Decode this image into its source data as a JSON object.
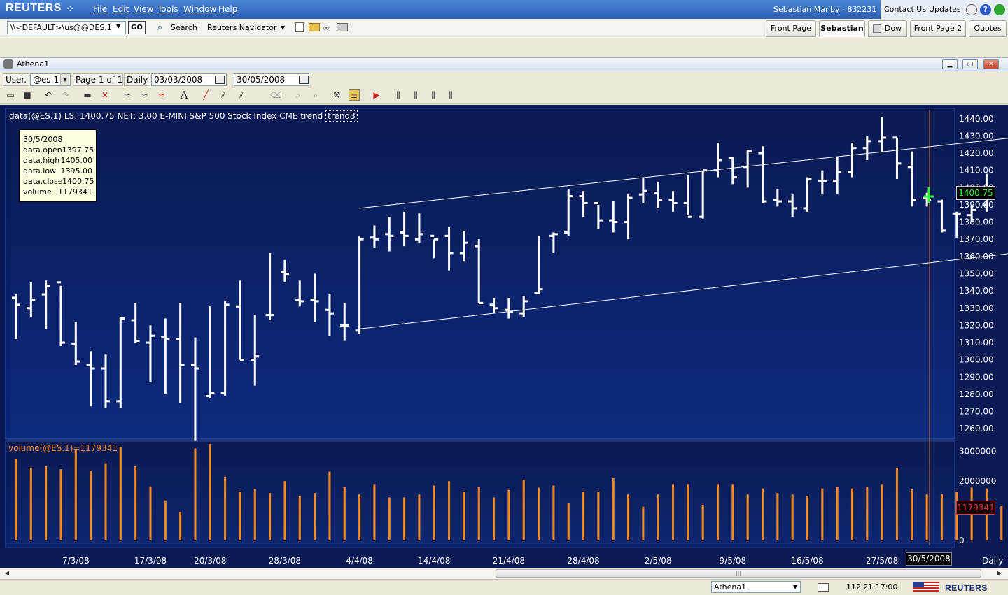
{
  "app": {
    "brand": "REUTERS",
    "menu": [
      "File",
      "Edit",
      "View",
      "Tools",
      "Window",
      "Help"
    ],
    "user": "Sebastian Manby - 832231",
    "contact": "Contact Us",
    "updates": "Updates"
  },
  "toolbar": {
    "ric_value": "\\\\<DEFAULT>\\us@@DES.1",
    "go_label": "GO",
    "search_label": "Search",
    "navigator_label": "Reuters Navigator",
    "tabs": [
      {
        "label": "Front Page",
        "active": false
      },
      {
        "label": "Sebastian",
        "active": true
      },
      {
        "label": "Dow",
        "active": false
      },
      {
        "label": "Front Page 2",
        "active": false
      },
      {
        "label": "Quotes",
        "active": false
      }
    ]
  },
  "window": {
    "title": "Athena1",
    "user_label": "User.",
    "symbol": "@es.1",
    "page_label": "Page 1 of 1",
    "interval": "Daily",
    "start_date": "03/03/2008",
    "end_date": "30/05/2008"
  },
  "chart_data": {
    "type": "ohlc",
    "header": "data(@ES.1) LS: 1400.75  NET: 3.00   E-MINI S&P 500 Stock Index CME trend",
    "trend_label": "trend3",
    "volume_label": "volume(@ES.1)=1179341",
    "last_price": "1400.75",
    "last_volume": "1179341",
    "period": "Daily",
    "cursor_date": "30/5/2008",
    "tooltip": [
      {
        "k": "30/5/2008",
        "v": ""
      },
      {
        "k": "data.open",
        "v": "1397.75"
      },
      {
        "k": "data.high",
        "v": "1405.00"
      },
      {
        "k": "data.low",
        "v": "1395.00"
      },
      {
        "k": "data.close",
        "v": "1400.75"
      },
      {
        "k": "volume",
        "v": "1179341"
      }
    ],
    "y_ticks": [
      1440,
      1430,
      1420,
      1410,
      1400,
      1390,
      1380,
      1370,
      1360,
      1350,
      1340,
      1330,
      1320,
      1310,
      1300,
      1290,
      1280,
      1270,
      1260
    ],
    "y_range": [
      1254,
      1446
    ],
    "volume_ticks": [
      3000000,
      2000000,
      0
    ],
    "volume_range": [
      0,
      3300000
    ],
    "x_ticks": [
      "7/3/08",
      "17/3/08",
      "20/3/08",
      "28/3/08",
      "4/4/08",
      "14/4/08",
      "21/4/08",
      "28/4/08",
      "2/5/08",
      "9/5/08",
      "16/5/08",
      "27/5/08"
    ],
    "x_tick_bar_index": [
      4,
      9,
      13,
      18,
      23,
      28,
      33,
      38,
      43,
      48,
      53,
      58
    ],
    "bars": [
      {
        "o": 1336,
        "h": 1338,
        "l": 1312,
        "c": 1332,
        "v": 2750000
      },
      {
        "o": 1330,
        "h": 1345,
        "l": 1325,
        "c": 1335,
        "v": 2450000
      },
      {
        "o": 1338,
        "h": 1346,
        "l": 1318,
        "c": 1343,
        "v": 2500000
      },
      {
        "o": 1345,
        "h": 1343,
        "l": 1308,
        "c": 1310,
        "v": 2400000
      },
      {
        "o": 1309,
        "h": 1322,
        "l": 1297,
        "c": 1299,
        "v": 3050000
      },
      {
        "o": 1297,
        "h": 1305,
        "l": 1273,
        "c": 1295,
        "v": 2350000
      },
      {
        "o": 1295,
        "h": 1303,
        "l": 1272,
        "c": 1276,
        "v": 2600000
      },
      {
        "o": 1276,
        "h": 1325,
        "l": 1272,
        "c": 1324,
        "v": 3150000
      },
      {
        "o": 1323,
        "h": 1333,
        "l": 1310,
        "c": 1311,
        "v": 2500000
      },
      {
        "o": 1310,
        "h": 1320,
        "l": 1287,
        "c": 1314,
        "v": 1820000
      },
      {
        "o": 1313,
        "h": 1324,
        "l": 1280,
        "c": 1312,
        "v": 1350000
      },
      {
        "o": 1312,
        "h": 1333,
        "l": 1275,
        "c": 1297,
        "v": 960000
      },
      {
        "o": 1297,
        "h": 1313,
        "l": 1253,
        "c": 1295,
        "v": 3100000
      },
      {
        "o": 1279,
        "h": 1331,
        "l": 1278,
        "c": 1281,
        "v": 3250000
      },
      {
        "o": 1281,
        "h": 1334,
        "l": 1279,
        "c": 1332,
        "v": 2150000
      },
      {
        "o": 1331,
        "h": 1346,
        "l": 1300,
        "c": 1300,
        "v": 1650000
      },
      {
        "o": 1300,
        "h": 1326,
        "l": 1285,
        "c": 1302,
        "v": 1730000
      },
      {
        "o": 1326,
        "h": 1362,
        "l": 1323,
        "c": 1326,
        "v": 1600000
      },
      {
        "o": 1351,
        "h": 1358,
        "l": 1345,
        "c": 1350,
        "v": 2000000
      },
      {
        "o": 1335,
        "h": 1346,
        "l": 1331,
        "c": 1334,
        "v": 1500000
      },
      {
        "o": 1335,
        "h": 1350,
        "l": 1322,
        "c": 1334,
        "v": 1600000
      },
      {
        "o": 1329,
        "h": 1338,
        "l": 1314,
        "c": 1327,
        "v": 2320000
      },
      {
        "o": 1320,
        "h": 1333,
        "l": 1311,
        "c": 1320,
        "v": 1800000
      },
      {
        "o": 1317,
        "h": 1372,
        "l": 1315,
        "c": 1370,
        "v": 1550000
      },
      {
        "o": 1371,
        "h": 1378,
        "l": 1365,
        "c": 1370,
        "v": 1900000
      },
      {
        "o": 1373,
        "h": 1383,
        "l": 1363,
        "c": 1372,
        "v": 1450000
      },
      {
        "o": 1374,
        "h": 1386,
        "l": 1366,
        "c": 1372,
        "v": 1450000
      },
      {
        "o": 1370,
        "h": 1385,
        "l": 1368,
        "c": 1373,
        "v": 1550000
      },
      {
        "o": 1372,
        "h": 1370,
        "l": 1359,
        "c": 1370,
        "v": 1850000
      },
      {
        "o": 1372,
        "h": 1377,
        "l": 1352,
        "c": 1362,
        "v": 2000000
      },
      {
        "o": 1362,
        "h": 1375,
        "l": 1357,
        "c": 1368,
        "v": 1650000
      },
      {
        "o": 1366,
        "h": 1370,
        "l": 1333,
        "c": 1333,
        "v": 1800000
      },
      {
        "o": 1332,
        "h": 1336,
        "l": 1327,
        "c": 1330,
        "v": 1450000
      },
      {
        "o": 1329,
        "h": 1336,
        "l": 1324,
        "c": 1328,
        "v": 1700000
      },
      {
        "o": 1327,
        "h": 1337,
        "l": 1325,
        "c": 1334,
        "v": 2050000
      },
      {
        "o": 1339,
        "h": 1372,
        "l": 1338,
        "c": 1341,
        "v": 1780000
      },
      {
        "o": 1372,
        "h": 1374,
        "l": 1362,
        "c": 1373,
        "v": 1850000
      },
      {
        "o": 1374,
        "h": 1399,
        "l": 1372,
        "c": 1395,
        "v": 1250000
      },
      {
        "o": 1395,
        "h": 1398,
        "l": 1383,
        "c": 1391,
        "v": 1650000
      },
      {
        "o": 1391,
        "h": 1390,
        "l": 1376,
        "c": 1381,
        "v": 1650000
      },
      {
        "o": 1381,
        "h": 1392,
        "l": 1374,
        "c": 1380,
        "v": 2100000
      },
      {
        "o": 1380,
        "h": 1396,
        "l": 1370,
        "c": 1394,
        "v": 1550000
      },
      {
        "o": 1396,
        "h": 1406,
        "l": 1391,
        "c": 1398,
        "v": 1140000
      },
      {
        "o": 1397,
        "h": 1403,
        "l": 1388,
        "c": 1393,
        "v": 1550000
      },
      {
        "o": 1393,
        "h": 1398,
        "l": 1386,
        "c": 1391,
        "v": 1900000
      },
      {
        "o": 1391,
        "h": 1407,
        "l": 1384,
        "c": 1383,
        "v": 1900000
      },
      {
        "o": 1383,
        "h": 1410,
        "l": 1382,
        "c": 1410,
        "v": 1200000
      },
      {
        "o": 1410,
        "h": 1426,
        "l": 1406,
        "c": 1416,
        "v": 1900000
      },
      {
        "o": 1417,
        "h": 1418,
        "l": 1402,
        "c": 1406,
        "v": 1900000
      },
      {
        "o": 1412,
        "h": 1422,
        "l": 1400,
        "c": 1421,
        "v": 1550000
      },
      {
        "o": 1420,
        "h": 1424,
        "l": 1391,
        "c": 1392,
        "v": 1750000
      },
      {
        "o": 1393,
        "h": 1399,
        "l": 1389,
        "c": 1392,
        "v": 1600000
      },
      {
        "o": 1392,
        "h": 1396,
        "l": 1383,
        "c": 1388,
        "v": 1550000
      },
      {
        "o": 1388,
        "h": 1406,
        "l": 1386,
        "c": 1405,
        "v": 1500000
      },
      {
        "o": 1404,
        "h": 1410,
        "l": 1396,
        "c": 1404,
        "v": 1750000
      },
      {
        "o": 1404,
        "h": 1418,
        "l": 1396,
        "c": 1409,
        "v": 1800000
      },
      {
        "o": 1409,
        "h": 1426,
        "l": 1406,
        "c": 1423,
        "v": 1750000
      },
      {
        "o": 1423,
        "h": 1430,
        "l": 1416,
        "c": 1427,
        "v": 1800000
      },
      {
        "o": 1427,
        "h": 1441,
        "l": 1421,
        "c": 1429,
        "v": 1900000
      },
      {
        "o": 1429,
        "h": 1429,
        "l": 1405,
        "c": 1414,
        "v": 2450000
      },
      {
        "o": 1412,
        "h": 1421,
        "l": 1389,
        "c": 1393,
        "v": 1720000
      },
      {
        "o": 1394,
        "h": 1397,
        "l": 1389,
        "c": 1393,
        "v": 1550000
      },
      {
        "o": 1392,
        "h": 1393,
        "l": 1374,
        "c": 1375,
        "v": 1560000
      },
      {
        "o": 1385,
        "h": 1386,
        "l": 1371,
        "c": 1385,
        "v": 1650000
      },
      {
        "o": 1384,
        "h": 1390,
        "l": 1380,
        "c": 1387,
        "v": 1780000
      },
      {
        "o": 1390,
        "h": 1408,
        "l": 1386,
        "c": 1399,
        "v": 1750000
      },
      {
        "o": 1397.75,
        "h": 1405,
        "l": 1395,
        "c": 1400.75,
        "v": 1179341
      }
    ],
    "trend_lines": [
      {
        "from": {
          "bar": 23,
          "y": 1388
        },
        "to": {
          "bar": 66.8,
          "y": 1429
        }
      },
      {
        "from": {
          "bar": 23,
          "y": 1318
        },
        "to": {
          "bar": 66.8,
          "y": 1362
        }
      }
    ]
  },
  "status": {
    "window_name": "Athena1",
    "count": "112",
    "time": "21:17:00",
    "brand": "REUTERS"
  }
}
